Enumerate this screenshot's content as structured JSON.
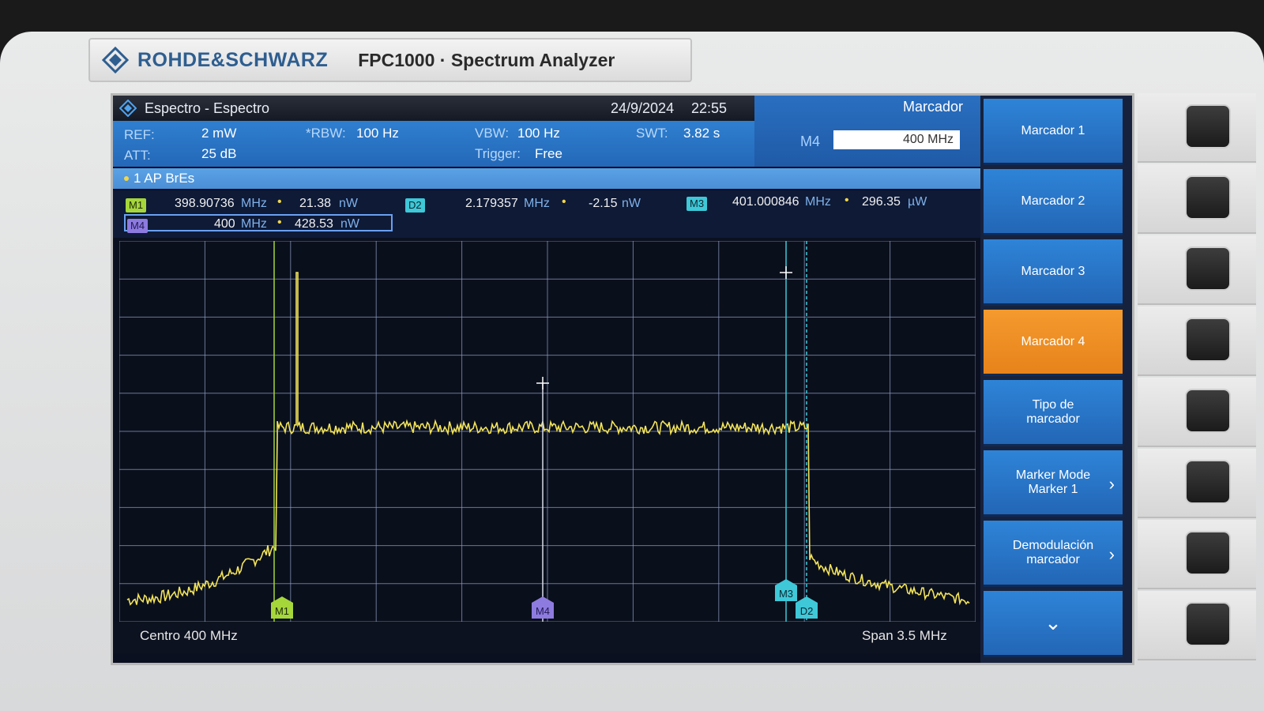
{
  "brand": {
    "name": "ROHDE&SCHWARZ",
    "model": "FPC1000 · Spectrum Analyzer"
  },
  "screen": {
    "title": "Espectro - Espectro",
    "date": "24/9/2024",
    "time": "22:55",
    "params": {
      "ref_label": "REF:",
      "ref_value": "2 mW",
      "att_label": "ATT:",
      "att_value": "25 dB",
      "rbw_label": "*RBW:",
      "rbw_value": "100 Hz",
      "vbw_label": "VBW:",
      "vbw_value": "100 Hz",
      "trigger_label": "Trigger:",
      "trigger_value": "Free",
      "swt_label": "SWT:",
      "swt_value": "3.82 s"
    },
    "marker_panel": {
      "title": "Marcador",
      "label": "M4",
      "input_value": "400 MHz"
    },
    "trace": {
      "label": "1 AP BrEs"
    },
    "markers": {
      "m1": {
        "tag": "M1",
        "freq": "398.90736",
        "freq_unit": "MHz",
        "level": "21.38",
        "level_unit": "nW"
      },
      "d2": {
        "tag": "D2",
        "freq": "2.179357",
        "freq_unit": "MHz",
        "level": "-2.15",
        "level_unit": "nW"
      },
      "m3": {
        "tag": "M3",
        "freq": "401.000846",
        "freq_unit": "MHz",
        "level": "296.35",
        "level_unit": "µW"
      },
      "m4": {
        "tag": "M4",
        "freq": "400",
        "freq_unit": "MHz",
        "level": "428.53",
        "level_unit": "nW"
      }
    },
    "footer": {
      "center": "Centro 400 MHz",
      "span": "Span 3.5 MHz"
    },
    "plot_markers": {
      "m1": "M1",
      "m3": "M3",
      "m4": "M4",
      "d2": "D2"
    }
  },
  "softkeys": [
    {
      "label": "Marcador 1",
      "active": false
    },
    {
      "label": "Marcador 2",
      "active": false
    },
    {
      "label": "Marcador 3",
      "active": false
    },
    {
      "label": "Marcador 4",
      "active": true
    },
    {
      "label": "Tipo de marcador",
      "active": false
    },
    {
      "label": "Marker Mode Marker 1",
      "active": false
    },
    {
      "label": "Demodulación marcador",
      "active": false
    },
    {
      "label": "⌄",
      "active": false
    }
  ],
  "colors": {
    "trace": "#f2e35a",
    "marker_m1": "#a5d63a",
    "marker_m3": "#3ec8d8",
    "marker_m4": "#8e7be0",
    "active_softkey": "#f49a2e"
  }
}
